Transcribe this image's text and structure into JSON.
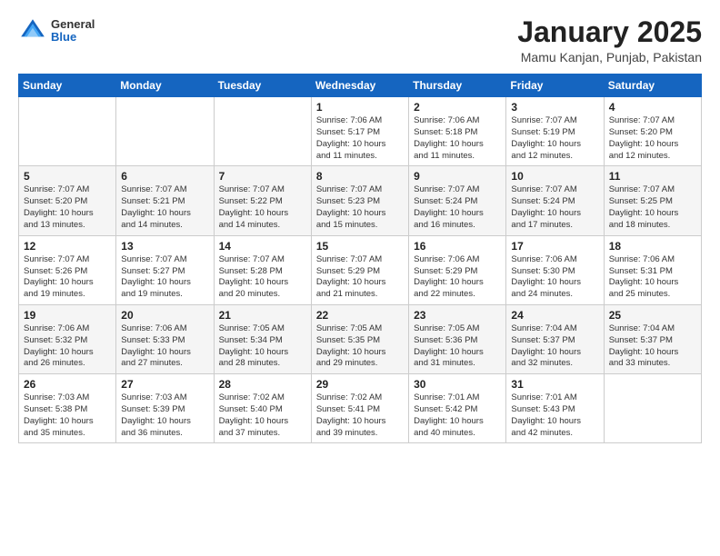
{
  "header": {
    "logo_general": "General",
    "logo_blue": "Blue",
    "month_title": "January 2025",
    "location": "Mamu Kanjan, Punjab, Pakistan"
  },
  "weekdays": [
    "Sunday",
    "Monday",
    "Tuesday",
    "Wednesday",
    "Thursday",
    "Friday",
    "Saturday"
  ],
  "weeks": [
    [
      {
        "day": "",
        "info": ""
      },
      {
        "day": "",
        "info": ""
      },
      {
        "day": "",
        "info": ""
      },
      {
        "day": "1",
        "info": "Sunrise: 7:06 AM\nSunset: 5:17 PM\nDaylight: 10 hours\nand 11 minutes."
      },
      {
        "day": "2",
        "info": "Sunrise: 7:06 AM\nSunset: 5:18 PM\nDaylight: 10 hours\nand 11 minutes."
      },
      {
        "day": "3",
        "info": "Sunrise: 7:07 AM\nSunset: 5:19 PM\nDaylight: 10 hours\nand 12 minutes."
      },
      {
        "day": "4",
        "info": "Sunrise: 7:07 AM\nSunset: 5:20 PM\nDaylight: 10 hours\nand 12 minutes."
      }
    ],
    [
      {
        "day": "5",
        "info": "Sunrise: 7:07 AM\nSunset: 5:20 PM\nDaylight: 10 hours\nand 13 minutes."
      },
      {
        "day": "6",
        "info": "Sunrise: 7:07 AM\nSunset: 5:21 PM\nDaylight: 10 hours\nand 14 minutes."
      },
      {
        "day": "7",
        "info": "Sunrise: 7:07 AM\nSunset: 5:22 PM\nDaylight: 10 hours\nand 14 minutes."
      },
      {
        "day": "8",
        "info": "Sunrise: 7:07 AM\nSunset: 5:23 PM\nDaylight: 10 hours\nand 15 minutes."
      },
      {
        "day": "9",
        "info": "Sunrise: 7:07 AM\nSunset: 5:24 PM\nDaylight: 10 hours\nand 16 minutes."
      },
      {
        "day": "10",
        "info": "Sunrise: 7:07 AM\nSunset: 5:24 PM\nDaylight: 10 hours\nand 17 minutes."
      },
      {
        "day": "11",
        "info": "Sunrise: 7:07 AM\nSunset: 5:25 PM\nDaylight: 10 hours\nand 18 minutes."
      }
    ],
    [
      {
        "day": "12",
        "info": "Sunrise: 7:07 AM\nSunset: 5:26 PM\nDaylight: 10 hours\nand 19 minutes."
      },
      {
        "day": "13",
        "info": "Sunrise: 7:07 AM\nSunset: 5:27 PM\nDaylight: 10 hours\nand 19 minutes."
      },
      {
        "day": "14",
        "info": "Sunrise: 7:07 AM\nSunset: 5:28 PM\nDaylight: 10 hours\nand 20 minutes."
      },
      {
        "day": "15",
        "info": "Sunrise: 7:07 AM\nSunset: 5:29 PM\nDaylight: 10 hours\nand 21 minutes."
      },
      {
        "day": "16",
        "info": "Sunrise: 7:06 AM\nSunset: 5:29 PM\nDaylight: 10 hours\nand 22 minutes."
      },
      {
        "day": "17",
        "info": "Sunrise: 7:06 AM\nSunset: 5:30 PM\nDaylight: 10 hours\nand 24 minutes."
      },
      {
        "day": "18",
        "info": "Sunrise: 7:06 AM\nSunset: 5:31 PM\nDaylight: 10 hours\nand 25 minutes."
      }
    ],
    [
      {
        "day": "19",
        "info": "Sunrise: 7:06 AM\nSunset: 5:32 PM\nDaylight: 10 hours\nand 26 minutes."
      },
      {
        "day": "20",
        "info": "Sunrise: 7:06 AM\nSunset: 5:33 PM\nDaylight: 10 hours\nand 27 minutes."
      },
      {
        "day": "21",
        "info": "Sunrise: 7:05 AM\nSunset: 5:34 PM\nDaylight: 10 hours\nand 28 minutes."
      },
      {
        "day": "22",
        "info": "Sunrise: 7:05 AM\nSunset: 5:35 PM\nDaylight: 10 hours\nand 29 minutes."
      },
      {
        "day": "23",
        "info": "Sunrise: 7:05 AM\nSunset: 5:36 PM\nDaylight: 10 hours\nand 31 minutes."
      },
      {
        "day": "24",
        "info": "Sunrise: 7:04 AM\nSunset: 5:37 PM\nDaylight: 10 hours\nand 32 minutes."
      },
      {
        "day": "25",
        "info": "Sunrise: 7:04 AM\nSunset: 5:37 PM\nDaylight: 10 hours\nand 33 minutes."
      }
    ],
    [
      {
        "day": "26",
        "info": "Sunrise: 7:03 AM\nSunset: 5:38 PM\nDaylight: 10 hours\nand 35 minutes."
      },
      {
        "day": "27",
        "info": "Sunrise: 7:03 AM\nSunset: 5:39 PM\nDaylight: 10 hours\nand 36 minutes."
      },
      {
        "day": "28",
        "info": "Sunrise: 7:02 AM\nSunset: 5:40 PM\nDaylight: 10 hours\nand 37 minutes."
      },
      {
        "day": "29",
        "info": "Sunrise: 7:02 AM\nSunset: 5:41 PM\nDaylight: 10 hours\nand 39 minutes."
      },
      {
        "day": "30",
        "info": "Sunrise: 7:01 AM\nSunset: 5:42 PM\nDaylight: 10 hours\nand 40 minutes."
      },
      {
        "day": "31",
        "info": "Sunrise: 7:01 AM\nSunset: 5:43 PM\nDaylight: 10 hours\nand 42 minutes."
      },
      {
        "day": "",
        "info": ""
      }
    ]
  ]
}
